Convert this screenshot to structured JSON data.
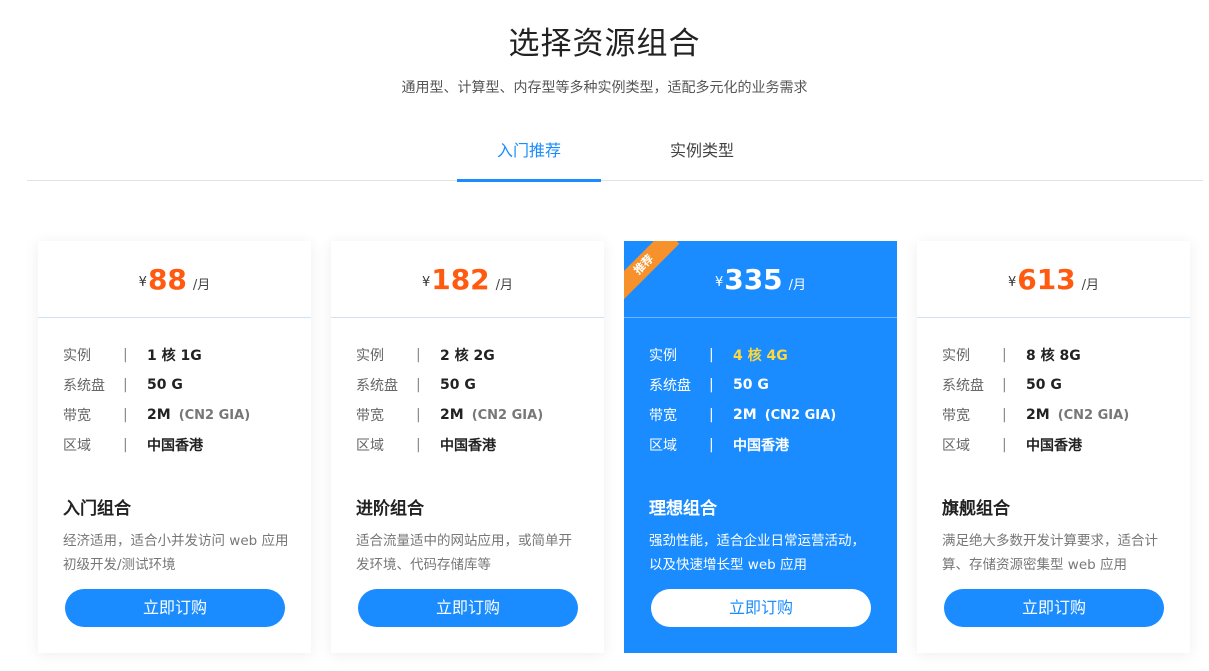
{
  "header": {
    "title": "选择资源组合",
    "subtitle": "通用型、计算型、内存型等多种实例类型，适配多元化的业务需求"
  },
  "tabs": [
    {
      "label": "入门推荐",
      "active": true
    },
    {
      "label": "实例类型",
      "active": false
    }
  ],
  "colors": {
    "accent": "#1a8cff",
    "price": "#ff5a10",
    "ribbon": "#f6912c",
    "highlight": "#ffd83a"
  },
  "spec_labels": {
    "instance": "实例",
    "disk": "系统盘",
    "bandwidth": "带宽",
    "region": "区域",
    "separator": "|"
  },
  "plans": [
    {
      "currency": "¥",
      "price": "88",
      "unit": "/月",
      "instance": "1 核 1G",
      "disk": "50 G",
      "bandwidth": "2M",
      "bandwidth_note": "(CN2 GIA)",
      "region": "中国香港",
      "name": "入门组合",
      "desc": "经济适用，适合小并发访问 web 应用初级开发/测试环境",
      "button": "立即订购"
    },
    {
      "currency": "¥",
      "price": "182",
      "unit": "/月",
      "instance": "2 核 2G",
      "disk": "50 G",
      "bandwidth": "2M",
      "bandwidth_note": "(CN2 GIA)",
      "region": "中国香港",
      "name": "进阶组合",
      "desc": "适合流量适中的网站应用，或简单开发环境、代码存储库等",
      "button": "立即订购"
    },
    {
      "currency": "¥",
      "price": "335",
      "unit": "/月",
      "ribbon": "推荐",
      "instance": "4 核 4G",
      "disk": "50 G",
      "bandwidth": "2M",
      "bandwidth_note": "(CN2 GIA)",
      "region": "中国香港",
      "name": "理想组合",
      "desc": "强劲性能，适合企业日常运营活动，以及快速增长型 web 应用",
      "button": "立即订购"
    },
    {
      "currency": "¥",
      "price": "613",
      "unit": "/月",
      "instance": "8 核 8G",
      "disk": "50 G",
      "bandwidth": "2M",
      "bandwidth_note": "(CN2 GIA)",
      "region": "中国香港",
      "name": "旗舰组合",
      "desc": "满足绝大多数开发计算要求，适合计算、存储资源密集型 web 应用",
      "button": "立即订购"
    }
  ]
}
